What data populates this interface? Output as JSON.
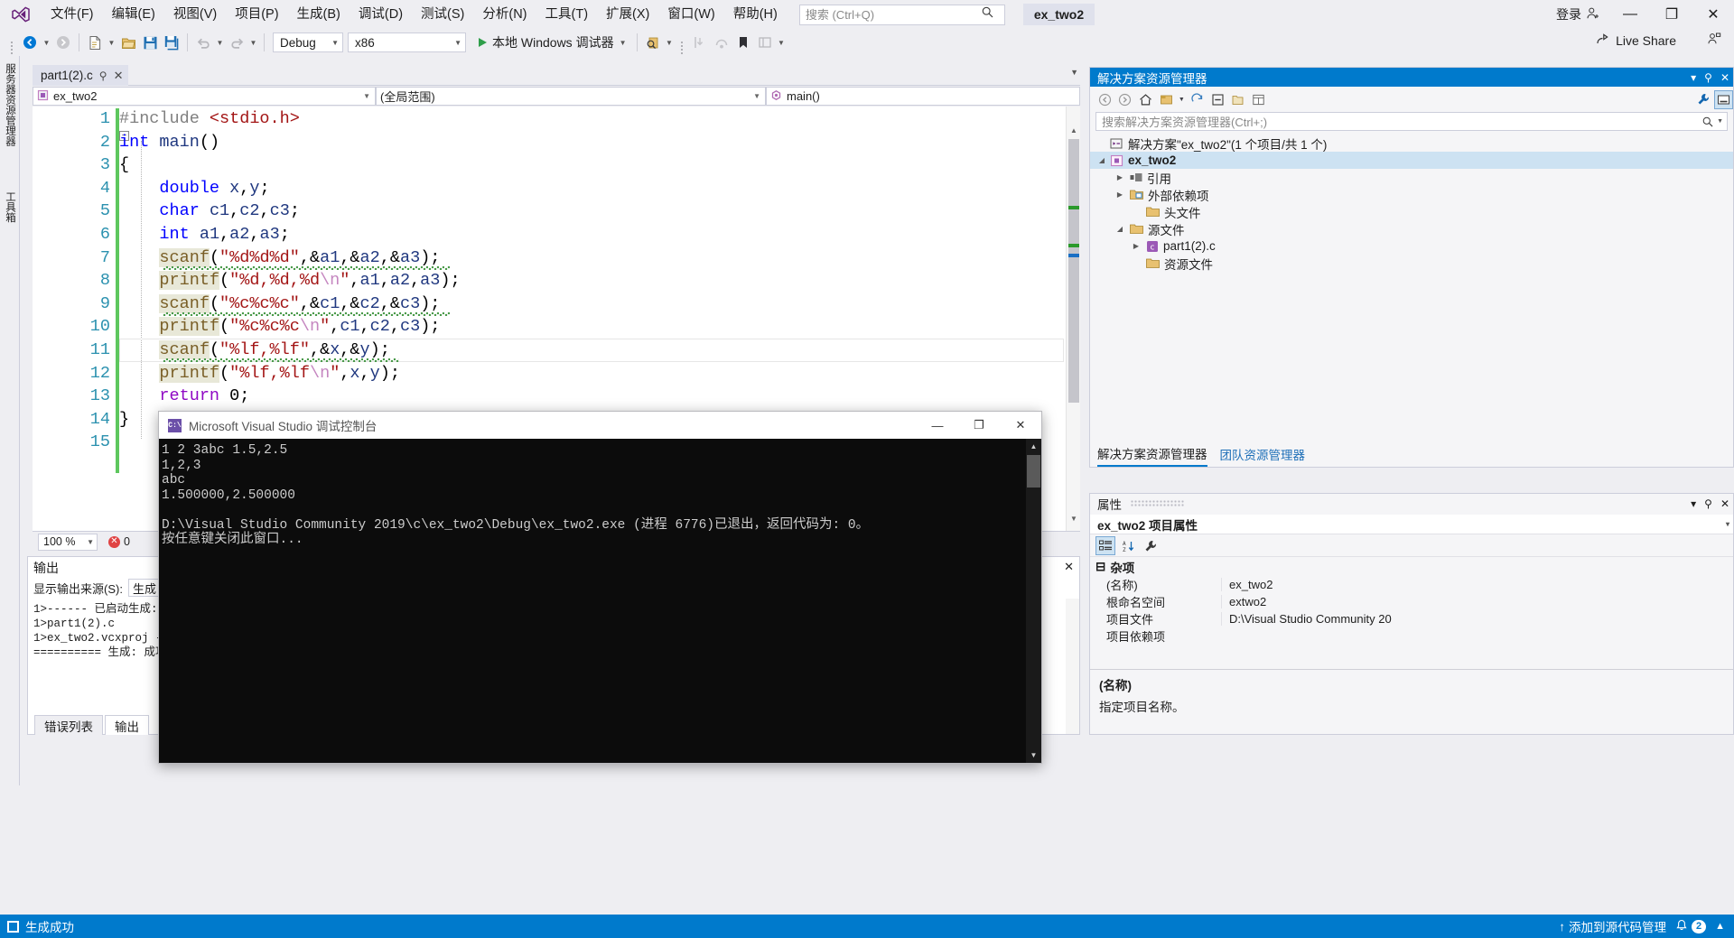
{
  "titlebar": {
    "menus": [
      "文件(F)",
      "编辑(E)",
      "视图(V)",
      "项目(P)",
      "生成(B)",
      "调试(D)",
      "测试(S)",
      "分析(N)",
      "工具(T)",
      "扩展(X)",
      "窗口(W)",
      "帮助(H)"
    ],
    "search_placeholder": "搜索 (Ctrl+Q)",
    "solution_name": "ex_two2",
    "signin": "登录",
    "minimize": "—",
    "maximize": "❐",
    "close": "✕"
  },
  "toolbar": {
    "config": "Debug",
    "platform": "x86",
    "run_label": "本地 Windows 调试器",
    "live_share": "Live Share"
  },
  "left_strip": {
    "items": [
      "服务器资源管理器",
      "工具箱"
    ]
  },
  "editor": {
    "tab_label": "part1(2).c",
    "nav_project": "ex_two2",
    "nav_scope": "(全局范围)",
    "nav_member": "main()",
    "zoom": "100 %",
    "error_count": "0",
    "line_numbers": [
      "1",
      "2",
      "3",
      "4",
      "5",
      "6",
      "7",
      "8",
      "9",
      "10",
      "11",
      "12",
      "13",
      "14",
      "15"
    ],
    "code_lines": [
      "#include <stdio.h>",
      "int main()",
      "{",
      "    double x,y;",
      "    char c1,c2,c3;",
      "    int a1,a2,a3;",
      "    scanf(\"%d%d%d\",&a1,&a2,&a3);",
      "    printf(\"%d,%d,%d\\n\",a1,a2,a3);",
      "    scanf(\"%c%c%c\",&c1,&c2,&c3);",
      "    printf(\"%c%c%c\\n\",c1,c2,c3);",
      "    scanf(\"%lf,%lf\",&x,&y);",
      "    printf(\"%lf,%lf\\n\",x,y);",
      "    return 0;",
      "}",
      ""
    ]
  },
  "output_panel": {
    "title": "输出",
    "source_label": "显示输出来源(S):",
    "source_value": "生成",
    "close": "✕",
    "lines": [
      "1>------ 已启动生成:",
      "1>part1(2).c",
      "1>ex_two2.vcxproj -> ",
      "========== 生成: 成功"
    ],
    "tabs": [
      {
        "label": "错误列表",
        "active": false
      },
      {
        "label": "输出",
        "active": true
      }
    ]
  },
  "solution_explorer": {
    "title": "解决方案资源管理器",
    "search_placeholder": "搜索解决方案资源管理器(Ctrl+;)",
    "pin": "📌",
    "close": "✕",
    "dropdown": "▾",
    "tree": [
      {
        "label": "解决方案\"ex_two2\"(1 个项目/共 1 个)",
        "indent": 8,
        "twisty": "",
        "icon": "solution-icon",
        "bold": false,
        "selected": false
      },
      {
        "label": "ex_two2",
        "indent": 16,
        "twisty": "▲",
        "icon": "project-icon",
        "bold": true,
        "selected": true
      },
      {
        "label": "引用",
        "indent": 34,
        "twisty": "▶",
        "icon": "references-icon",
        "bold": false,
        "selected": false
      },
      {
        "label": "外部依赖项",
        "indent": 34,
        "twisty": "▶",
        "icon": "folder-ext-icon",
        "bold": false,
        "selected": false
      },
      {
        "label": "头文件",
        "indent": 52,
        "twisty": "",
        "icon": "folder-icon",
        "bold": false,
        "selected": false
      },
      {
        "label": "源文件",
        "indent": 34,
        "twisty": "▲",
        "icon": "folder-icon",
        "bold": false,
        "selected": false
      },
      {
        "label": "part1(2).c",
        "indent": 52,
        "twisty": "▶",
        "icon": "c-file-icon",
        "bold": false,
        "selected": false
      },
      {
        "label": "资源文件",
        "indent": 52,
        "twisty": "",
        "icon": "folder-icon",
        "bold": false,
        "selected": false
      }
    ],
    "bottom_tabs": [
      {
        "label": "解决方案资源管理器",
        "active": true
      },
      {
        "label": "团队资源管理器",
        "active": false
      }
    ]
  },
  "properties": {
    "title": "属性",
    "pin": "📌",
    "close": "✕",
    "dropdown": "▾",
    "object_name": "ex_two2 项目属性",
    "object_dropdown": "▾",
    "category": "杂项",
    "category_toggle": "⊟",
    "rows": [
      {
        "key": "(名称)",
        "value": "ex_two2"
      },
      {
        "key": "根命名空间",
        "value": "extwo2"
      },
      {
        "key": "项目文件",
        "value": "D:\\Visual Studio Community 20"
      },
      {
        "key": "项目依赖项",
        "value": ""
      }
    ],
    "desc_title": "(名称)",
    "desc_text": "指定项目名称。"
  },
  "console": {
    "title": "Microsoft Visual Studio 调试控制台",
    "icon_text": "C:\\",
    "minimize": "—",
    "maximize": "❐",
    "close": "✕",
    "lines": [
      "1 2 3abc 1.5,2.5",
      "1,2,3",
      "abc",
      "1.500000,2.500000",
      "",
      "D:\\Visual Studio Community 2019\\c\\ex_two2\\Debug\\ex_two2.exe (进程 6776)已退出，返回代码为: 0。",
      "按任意键关闭此窗口..."
    ]
  },
  "statusbar": {
    "build_status": "生成成功",
    "add_to_source": "添加到源代码管理",
    "notify_count": "2",
    "up_arrow": "↑",
    "bell": "🔔"
  },
  "colors": {
    "accent": "#007acc",
    "titlebar_bg": "#eeeef2",
    "editor_bg": "#ffffff",
    "console_bg": "#0c0c0c",
    "change_bar": "#5ec75e",
    "keyword": "#0000ff",
    "string": "#a31515",
    "function": "#795e26",
    "escape": "#c586c0",
    "linenum": "#2b91af",
    "return_kw": "#8f08c4"
  }
}
